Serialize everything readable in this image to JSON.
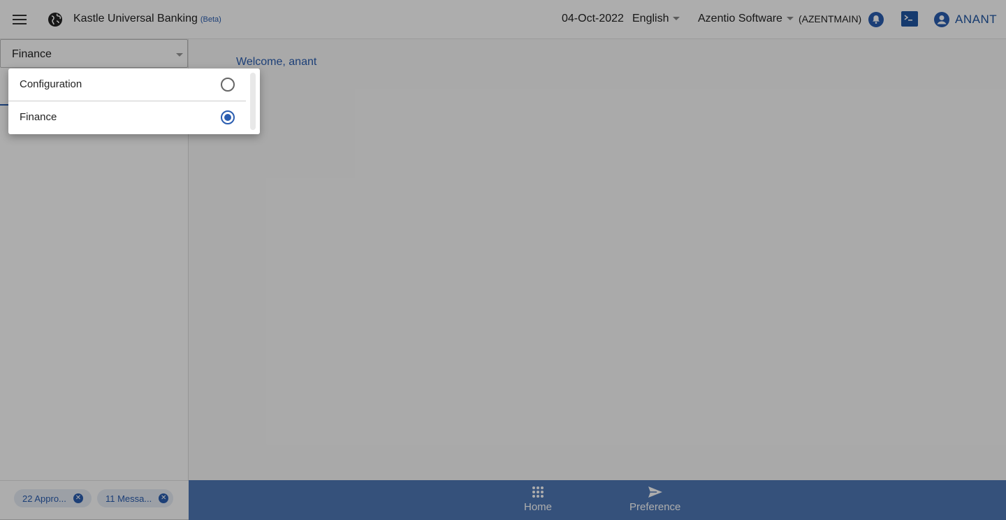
{
  "header": {
    "app_title": "Kastle Universal Banking",
    "beta_label": "(Beta)",
    "date": "04-Oct-2022",
    "language": "English",
    "company": "Azentio Software",
    "branch": "(AZENTMAIN)",
    "user_name": "ANANT",
    "icons": [
      "menu-icon",
      "globe-icon",
      "bell-icon",
      "terminal-icon",
      "user-icon"
    ]
  },
  "sidebar": {
    "module_selected": "Finance",
    "chips": [
      {
        "label": "22 Appro..."
      },
      {
        "label": "11 Messa..."
      }
    ]
  },
  "main": {
    "welcome": "Welcome, anant"
  },
  "bottom_nav": {
    "items": [
      {
        "label": "Home",
        "icon": "grid-icon"
      },
      {
        "label": "Preference",
        "icon": "send-icon"
      }
    ]
  },
  "module_dropdown": {
    "options": [
      {
        "label": "Configuration",
        "selected": false
      },
      {
        "label": "Finance",
        "selected": true
      }
    ]
  },
  "colors": {
    "accent": "#2a5db0",
    "bottom_bar": "#4f78b5",
    "overlay": "rgba(0,0,0,0.32)"
  }
}
